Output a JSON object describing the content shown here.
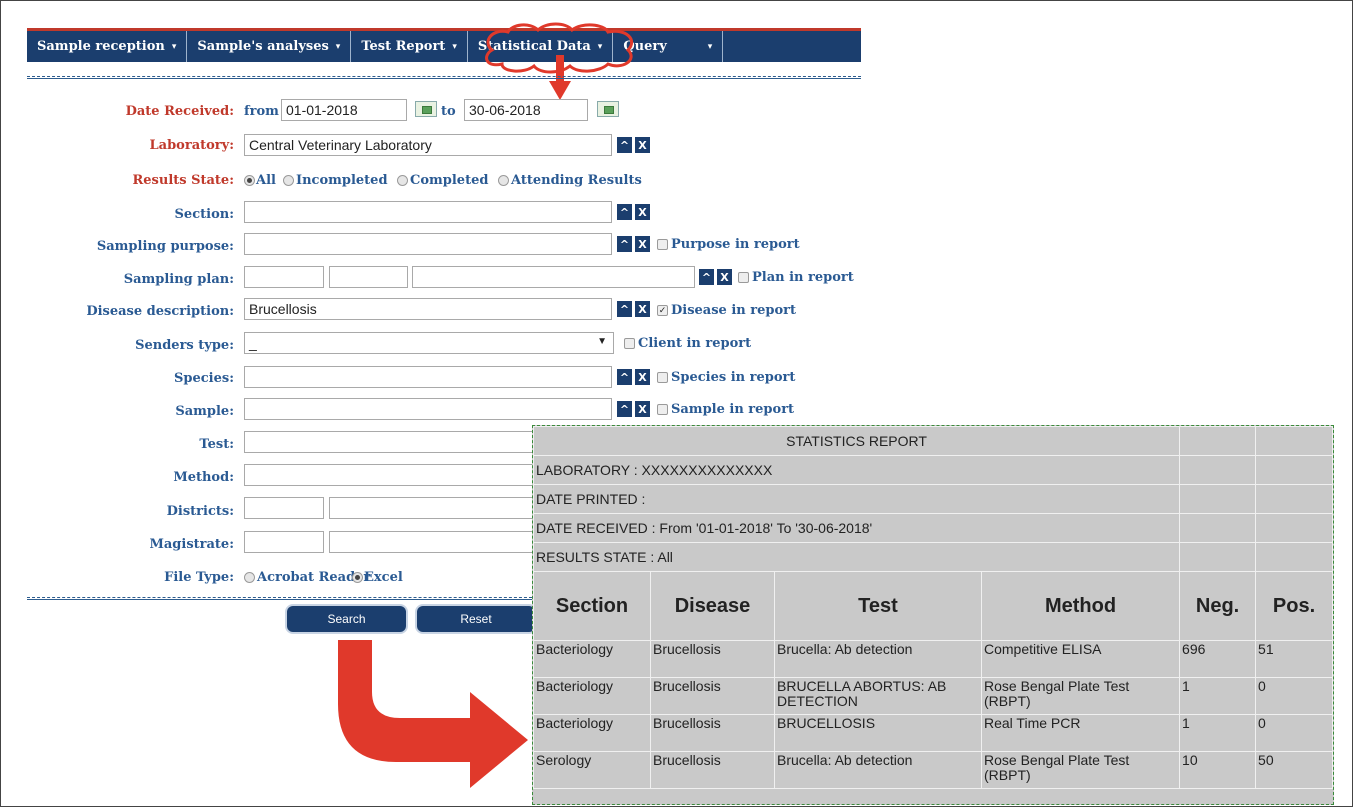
{
  "nav": {
    "items": [
      {
        "label": "Sample reception"
      },
      {
        "label": "Sample's analyses"
      },
      {
        "label": "Test Report"
      },
      {
        "label": "Statistical Data"
      },
      {
        "label": "Query"
      }
    ],
    "caret": "▾"
  },
  "form": {
    "date_received": {
      "label": "Date Received:",
      "from_label": "from",
      "from_value": "01-01-2018",
      "to_label": "to",
      "to_value": "30-06-2018"
    },
    "laboratory": {
      "label": "Laboratory:",
      "value": "Central Veterinary Laboratory"
    },
    "results_state": {
      "label": "Results State:",
      "options": [
        "All",
        "Incompleted",
        "Completed",
        "Attending Results"
      ],
      "selected": "All"
    },
    "section": {
      "label": "Section:",
      "value": ""
    },
    "sampling_purpose": {
      "label": "Sampling purpose:",
      "value": "",
      "checkbox_label": "Purpose in report",
      "checked": false
    },
    "sampling_plan": {
      "label": "Sampling plan:",
      "checkbox_label": "Plan in report",
      "checked": false
    },
    "disease_description": {
      "label": "Disease description:",
      "value": "Brucellosis",
      "checkbox_label": "Disease in report",
      "checked": true
    },
    "senders_type": {
      "label": "Senders type:",
      "value": "_",
      "checkbox_label": "Client in report",
      "checked": false
    },
    "species": {
      "label": "Species:",
      "value": "",
      "checkbox_label": "Species in report",
      "checked": false
    },
    "sample": {
      "label": "Sample:",
      "value": "",
      "checkbox_label": "Sample in report",
      "checked": false
    },
    "test": {
      "label": "Test:"
    },
    "method": {
      "label": "Method:"
    },
    "districts": {
      "label": "Districts:"
    },
    "magistrate": {
      "label": "Magistrate:"
    },
    "file_type": {
      "label": "File Type:",
      "options": [
        "Acrobat Reader",
        "Excel"
      ],
      "selected": "Excel"
    },
    "buttons": {
      "search": "Search",
      "reset": "Reset"
    },
    "btn_up": "^",
    "btn_clear": "X",
    "check_mark": "✓"
  },
  "report": {
    "title": "STATISTICS REPORT",
    "meta": [
      "LABORATORY :   XXXXXXXXXXXXXX",
      "DATE PRINTED :",
      "DATE RECEIVED :   From  '01-01-2018'  To  '30-06-2018'",
      "RESULTS STATE :  All"
    ],
    "columns": [
      "Section",
      "Disease",
      "Test",
      "Method",
      "Neg.",
      "Pos."
    ],
    "rows": [
      [
        "Bacteriology",
        "Brucellosis",
        "Brucella: Ab detection",
        "Competitive ELISA",
        "696",
        "51"
      ],
      [
        "Bacteriology",
        "Brucellosis",
        "BRUCELLA ABORTUS: AB DETECTION",
        "Rose Bengal Plate Test (RBPT)",
        "1",
        "0"
      ],
      [
        "Bacteriology",
        "Brucellosis",
        "BRUCELLOSIS",
        "Real Time PCR",
        "1",
        "0"
      ],
      [
        "Serology",
        "Brucellosis",
        "Brucella: Ab detection",
        "Rose Bengal Plate Test (RBPT)",
        "10",
        "50"
      ]
    ]
  },
  "colors": {
    "nav_bg": "#1b3e6e",
    "label_blue": "#2a5a93",
    "label_red": "#c0392b",
    "report_bg": "#c9c9c9",
    "arrow": "#e0392b"
  }
}
